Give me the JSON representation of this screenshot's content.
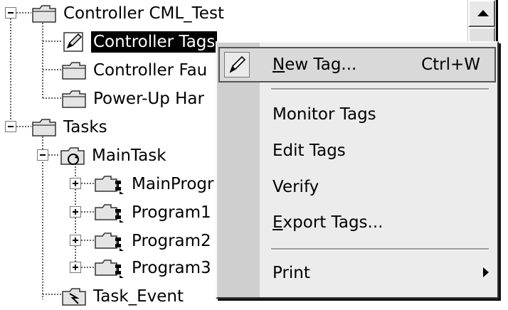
{
  "tree": {
    "controller_label": "Controller CML_Test",
    "controller_tags_label": "Controller Tags",
    "controller_faults_label": "Controller Fau",
    "power_up_label": "Power-Up Har",
    "tasks_label": "Tasks",
    "main_task_label": "MainTask",
    "main_program_label": "MainProgr",
    "program1_label": "Program1",
    "program2_label": "Program2",
    "program3_label": "Program3",
    "task_event_label": "Task_Event"
  },
  "context_menu": {
    "items": [
      {
        "label": "New Tag...",
        "mnemonic": "N",
        "label_rest": "ew Tag...",
        "shortcut": "Ctrl+W",
        "icon": "pencil-icon",
        "highlighted": true
      },
      {
        "label": "Monitor Tags"
      },
      {
        "label": "Edit Tags"
      },
      {
        "label": "Verify"
      },
      {
        "label": "Export Tags...",
        "mnemonic": "E",
        "label_rest": "xport Tags..."
      },
      {
        "label": "Print",
        "submenu": true
      }
    ]
  },
  "icons": {
    "folder": "folder-icon",
    "tag_pencil": "pencil-icon",
    "task_cycle": "cyclic-task-icon",
    "program": "program-folder-icon"
  }
}
